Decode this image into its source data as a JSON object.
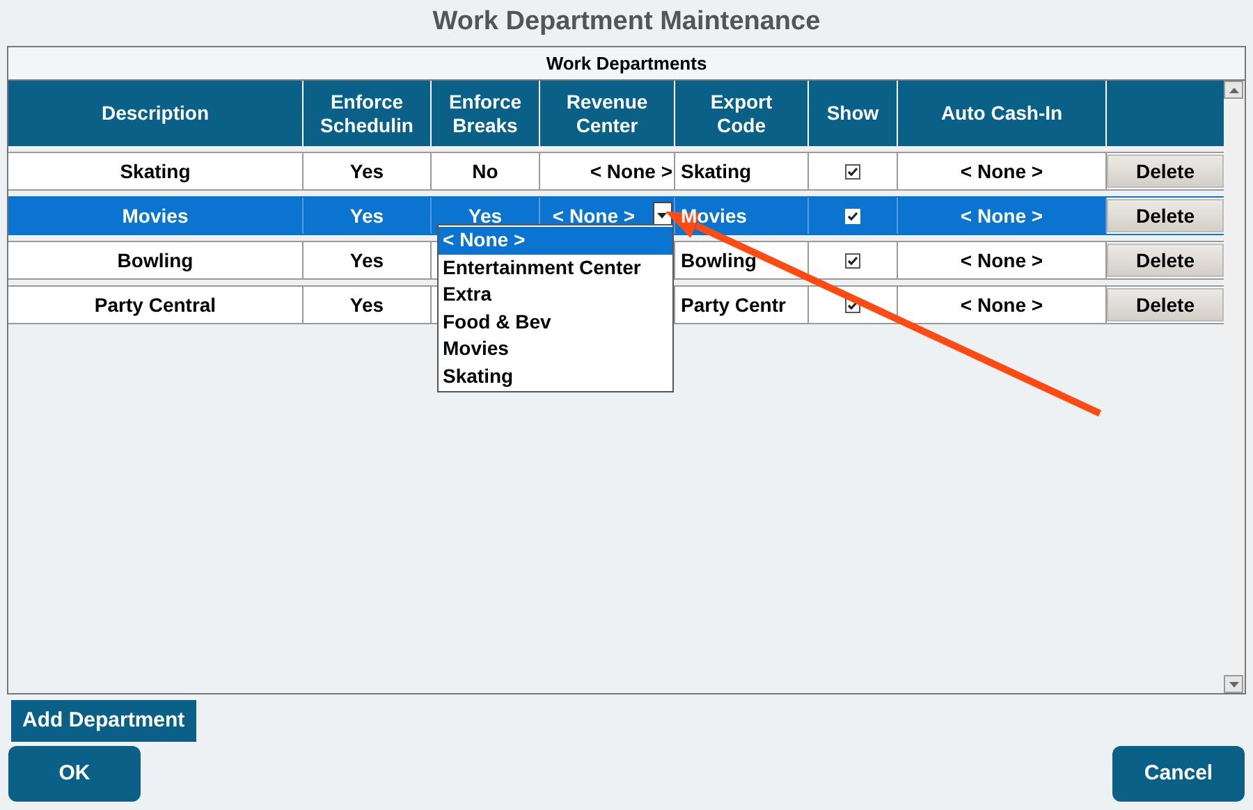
{
  "title": "Work Department Maintenance",
  "panel": {
    "caption": "Work Departments"
  },
  "columns": [
    "Description",
    "Enforce Schedulin",
    "Enforce Breaks",
    "Revenue Center",
    "Export Code",
    "Show",
    "Auto Cash-In"
  ],
  "rows": [
    {
      "description": "Skating",
      "scheduling": "Yes",
      "breaks": "No",
      "revenue": "< None >",
      "export": "Skating",
      "show": true,
      "auto": "< None >",
      "action": "Delete",
      "selected": false
    },
    {
      "description": "Movies",
      "scheduling": "Yes",
      "breaks": "Yes",
      "revenue": "< None >",
      "export": "Movies",
      "show": true,
      "auto": "< None >",
      "action": "Delete",
      "selected": true
    },
    {
      "description": "Bowling",
      "scheduling": "Yes",
      "export": "Bowling",
      "show": true,
      "auto": "< None >",
      "action": "Delete",
      "selected": false
    },
    {
      "description": "Party Central",
      "scheduling": "Yes",
      "export": "Party Centr",
      "show": true,
      "auto": "< None >",
      "action": "Delete",
      "selected": false
    }
  ],
  "revenue_dropdown": {
    "items": [
      {
        "label": "< None >",
        "selected": true
      },
      {
        "label": "Entertainment Center",
        "selected": false
      },
      {
        "label": "Extra",
        "selected": false
      },
      {
        "label": "Food & Bev",
        "selected": false
      },
      {
        "label": "Movies",
        "selected": false
      },
      {
        "label": "Skating",
        "selected": false
      }
    ]
  },
  "add_button": "Add Department",
  "buttons": [
    "OK",
    "Cancel"
  ]
}
